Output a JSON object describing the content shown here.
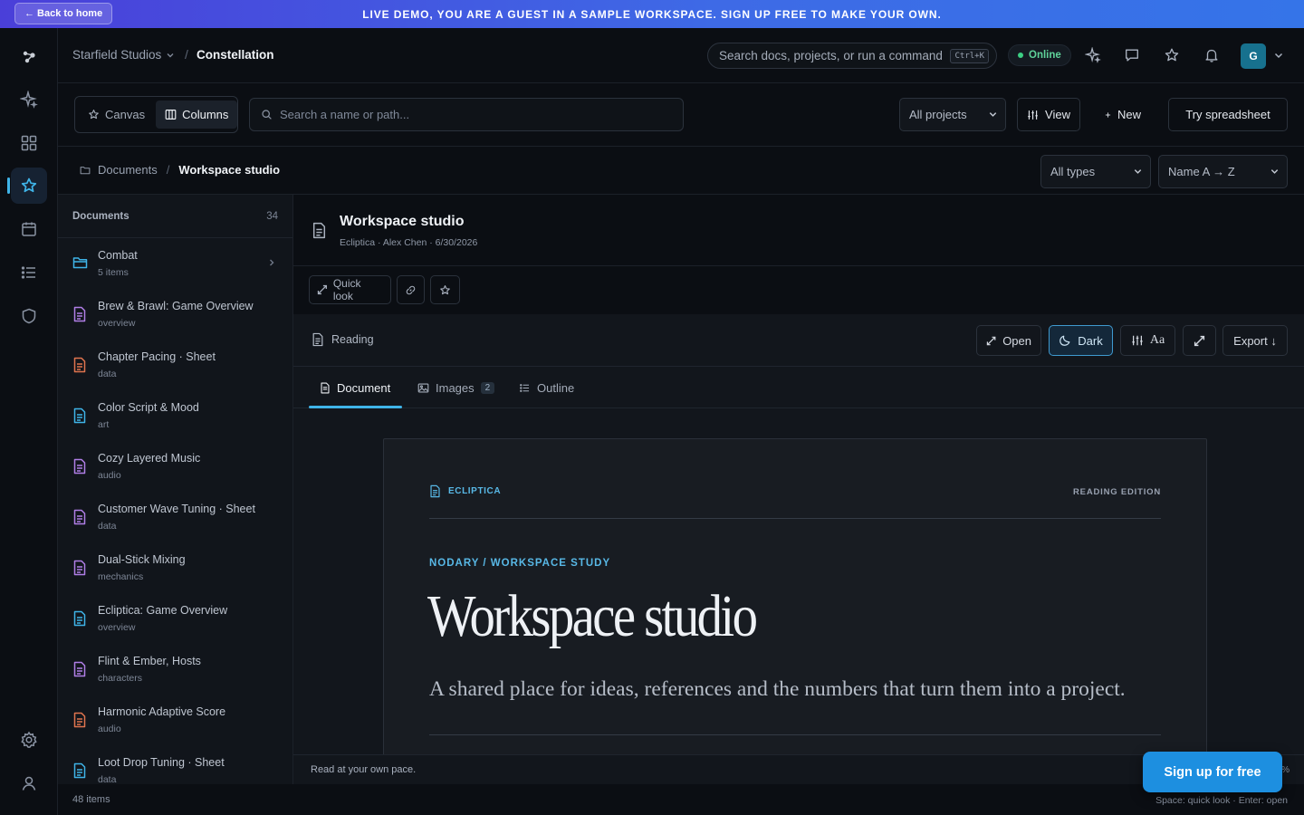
{
  "banner": {
    "back_label": "← Back to home",
    "text": "LIVE DEMO, YOU ARE A GUEST IN A SAMPLE WORKSPACE. SIGN UP FREE TO MAKE YOUR OWN."
  },
  "rail": {
    "items": [
      "logo-icon",
      "sparkles-icon",
      "grid-icon",
      "constellation-icon",
      "calendar-icon",
      "list-icon",
      "shield-icon",
      "settings-icon",
      "user-icon"
    ],
    "active": "constellation-icon",
    "accent": "#3fb4e8"
  },
  "header": {
    "org": "Starfield Studios",
    "separator": "/",
    "project": "Constellation",
    "search_placeholder": "Search docs, projects, or run a command",
    "shortcut": "Ctrl+K",
    "status": "Online",
    "status_color": "#3ccf83",
    "avatar_initial": "G",
    "icons": [
      "sparkle-icon",
      "chat-icon",
      "star-icon",
      "bell-icon"
    ]
  },
  "toolbar": {
    "view_canvas": "Canvas",
    "view_columns": "Columns",
    "active_view": "Columns",
    "path_placeholder": "Search a name or path...",
    "projects_select": "All projects",
    "view_button": "View",
    "new_button": "New",
    "spreadsheet_button": "Try spreadsheet"
  },
  "breadcrumb": {
    "root": "Documents",
    "separator": "/",
    "current": "Workspace studio",
    "type_select": "All types",
    "sort_select": "Name A → Z"
  },
  "sidebar": {
    "title": "Documents",
    "count": "34",
    "items": [
      {
        "name": "Combat",
        "sub": "5 items",
        "kind": "folder",
        "color": "#3fb4e8"
      },
      {
        "name": "Brew & Brawl: Game Overview",
        "sub": "overview",
        "kind": "doc",
        "color": "#b07ee6"
      },
      {
        "name": "Chapter Pacing · Sheet",
        "sub": "data",
        "kind": "doc",
        "color": "#e0744e"
      },
      {
        "name": "Color Script & Mood",
        "sub": "art",
        "kind": "doc",
        "color": "#3fb4e8"
      },
      {
        "name": "Cozy Layered Music",
        "sub": "audio",
        "kind": "doc",
        "color": "#b07ee6"
      },
      {
        "name": "Customer Wave Tuning · Sheet",
        "sub": "data",
        "kind": "doc",
        "color": "#b07ee6"
      },
      {
        "name": "Dual-Stick Mixing",
        "sub": "mechanics",
        "kind": "doc",
        "color": "#b07ee6"
      },
      {
        "name": "Ecliptica: Game Overview",
        "sub": "overview",
        "kind": "doc",
        "color": "#3fb4e8"
      },
      {
        "name": "Flint & Ember, Hosts",
        "sub": "characters",
        "kind": "doc",
        "color": "#b07ee6"
      },
      {
        "name": "Harmonic Adaptive Score",
        "sub": "audio",
        "kind": "doc",
        "color": "#e0744e"
      },
      {
        "name": "Loot Drop Tuning · Sheet",
        "sub": "data",
        "kind": "doc",
        "color": "#3fb4e8"
      }
    ],
    "footer": "48 items"
  },
  "document": {
    "title": "Workspace studio",
    "meta": "Ecliptica · Alex Chen · 6/30/2026",
    "quick_look": "Quick look",
    "reading_label": "Reading",
    "open_button": "Open",
    "theme_button": "Dark",
    "font_button": "Aa",
    "export_button": "Export ↓",
    "tabs": [
      {
        "label": "Document",
        "badge": ""
      },
      {
        "label": "Images",
        "badge": "2"
      },
      {
        "label": "Outline",
        "badge": ""
      }
    ],
    "active_tab": "Document",
    "paper": {
      "kicker": "ECLIPTICA",
      "edition": "READING EDITION",
      "eyebrow": "NODARY / WORKSPACE STUDY",
      "title": "Workspace studio",
      "lede": "A shared place for ideas, references and the numbers that turn them into a project."
    },
    "footer_note": "Read at your own pace.",
    "pct": "%"
  },
  "footer": {
    "hint": "Space: quick look · Enter: open"
  },
  "cta": {
    "signup": "Sign up for free",
    "color": "#1d8fe0"
  }
}
